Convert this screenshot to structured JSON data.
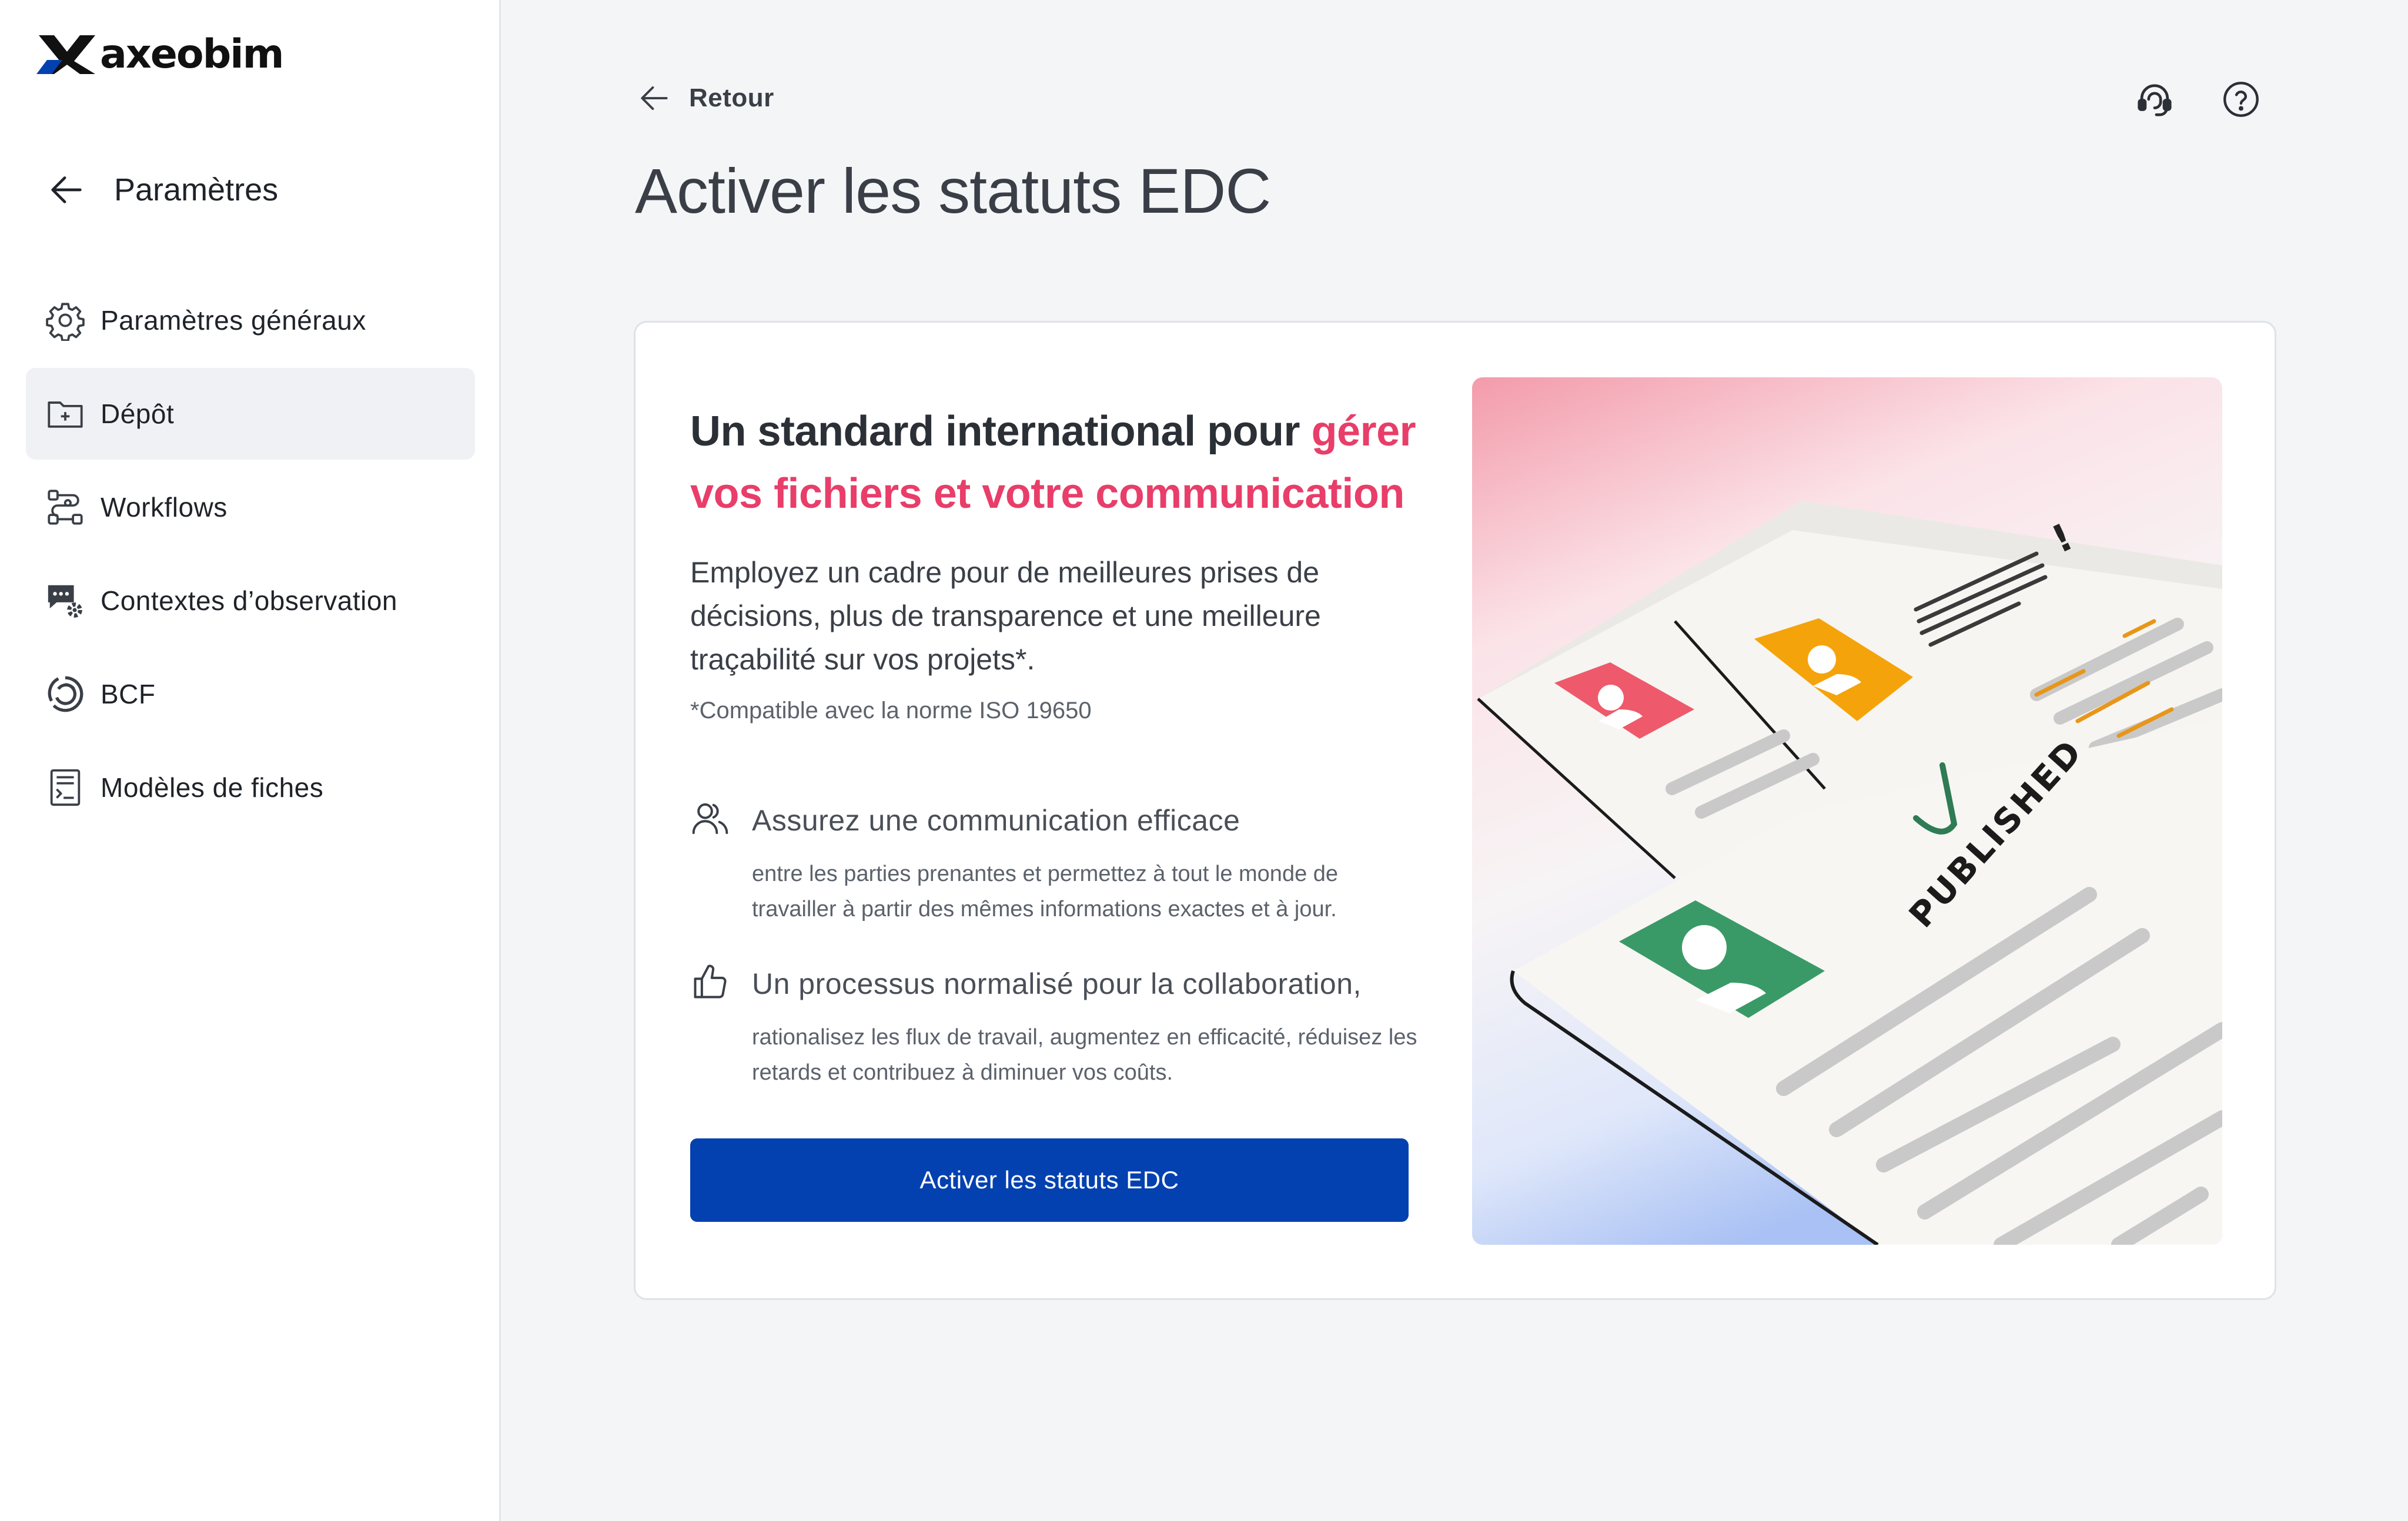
{
  "brand": {
    "name": "axeobim",
    "accent": "#0441b0",
    "highlight": "#e83e69"
  },
  "sidebar": {
    "back_label": "Paramètres",
    "items": [
      {
        "label": "Paramètres généraux",
        "icon": "gear-icon",
        "active": false
      },
      {
        "label": "Dépôt",
        "icon": "folder-plus-icon",
        "active": true
      },
      {
        "label": "Workflows",
        "icon": "workflow-icon",
        "active": false
      },
      {
        "label": "Contextes d’observation",
        "icon": "chat-settings-icon",
        "active": false
      },
      {
        "label": "BCF",
        "icon": "bcf-icon",
        "active": false
      },
      {
        "label": "Modèles de fiches",
        "icon": "form-template-icon",
        "active": false
      }
    ]
  },
  "header": {
    "back_label": "Retour",
    "title": "Activer les statuts EDC",
    "support_icon": "headset-icon",
    "help_icon": "help-circle-icon"
  },
  "card": {
    "headline_plain": "Un standard international pour ",
    "headline_accent": "gérer vos fichiers et votre communication",
    "lead": "Employez un cadre pour de meilleures prises de décisions, plus de transparence et une meilleure traçabilité sur vos projets*.",
    "footnote": "*Compatible avec la norme ISO 19650",
    "features": [
      {
        "icon": "users-icon",
        "title": "Assurez une communication efficace",
        "description": "entre les parties prenantes et permettez à tout le monde de travailler à partir des mêmes informations exactes et à jour."
      },
      {
        "icon": "thumbs-up-icon",
        "title": "Un processus normalisé pour la collaboration,",
        "description": "rationalisez les flux de travail, augmentez en efficacité, réduisez les retards et contribuez à diminuer vos coûts."
      }
    ],
    "cta_label": "Activer les statuts EDC",
    "illustration": {
      "stamp_text": "PUBLISHED",
      "exclamation": "!",
      "card_colors": [
        "#ee5a6b",
        "#f5a30a",
        "#3a9a67"
      ]
    }
  }
}
